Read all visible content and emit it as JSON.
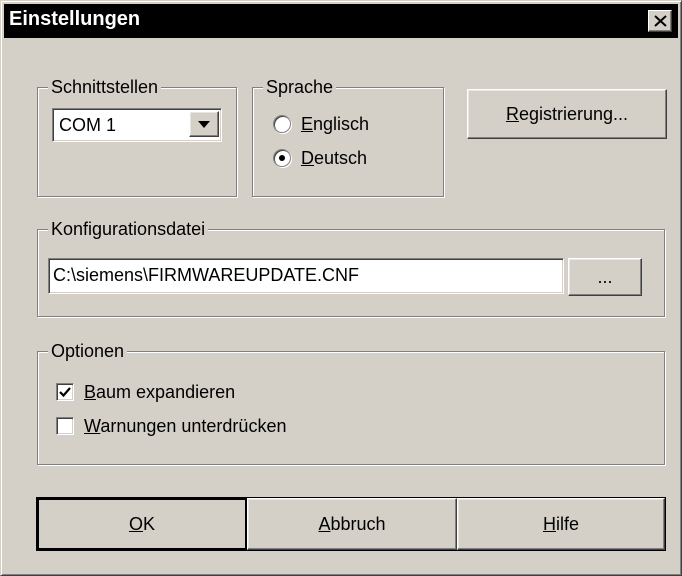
{
  "window": {
    "title": "Einstellungen",
    "close_label": "✕"
  },
  "interfaces": {
    "group_label": "Schnittstellen",
    "selected_port": "COM 1"
  },
  "language": {
    "group_label": "Sprache",
    "options": [
      {
        "label": "Englisch",
        "selected": false,
        "mnemonic": "E"
      },
      {
        "label": "Deutsch",
        "selected": true,
        "mnemonic": "D"
      }
    ]
  },
  "registration_button": {
    "label": "Registrierung...",
    "mnemonic": "R"
  },
  "config_file": {
    "group_label": "Konfigurationsdatei",
    "path": "C:\\siemens\\FIRMWAREUPDATE.CNF",
    "browse_label": "..."
  },
  "options": {
    "group_label": "Optionen",
    "items": [
      {
        "label": "Baum expandieren",
        "checked": true,
        "mnemonic": "B"
      },
      {
        "label": "Warnungen unterdrücken",
        "checked": false,
        "mnemonic": "W"
      }
    ]
  },
  "footer": {
    "ok_label": "OK",
    "cancel_label": "Abbruch",
    "help_label": "Hilfe"
  }
}
